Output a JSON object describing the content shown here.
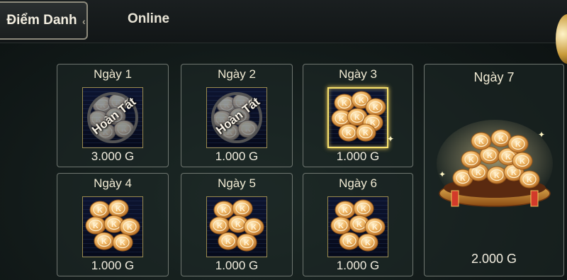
{
  "tabs": {
    "active_label": "Điểm Danh",
    "other_label": "Online"
  },
  "rewards": [
    {
      "day": "Ngày 1",
      "amount": "3.000 G",
      "status": "Hoàn Tất"
    },
    {
      "day": "Ngày 2",
      "amount": "1.000 G",
      "status": "Hoàn Tất"
    },
    {
      "day": "Ngày 3",
      "amount": "1.000 G",
      "status": ""
    },
    {
      "day": "Ngày 4",
      "amount": "1.000 G",
      "status": ""
    },
    {
      "day": "Ngày 5",
      "amount": "1.000 G",
      "status": ""
    },
    {
      "day": "Ngày 6",
      "amount": "1.000 G",
      "status": ""
    },
    {
      "day": "Ngày 7",
      "amount": "2.000 G",
      "status": ""
    }
  ],
  "colors": {
    "accent_gold": "#f7e06c",
    "coin": "#e9a24a",
    "panel_border": "#6f7670"
  }
}
